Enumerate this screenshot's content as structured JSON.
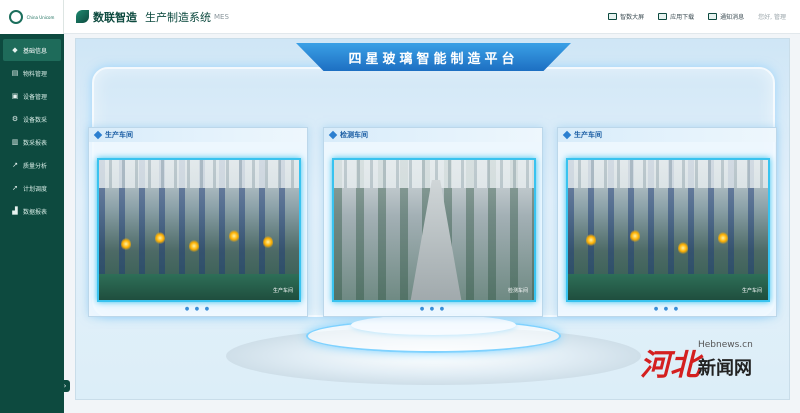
{
  "sidebar": {
    "logo_caption": "China Unicom",
    "items": [
      {
        "label": "基础信息",
        "icon": "diamond-icon",
        "active": true
      },
      {
        "label": "物料管理",
        "icon": "box-icon"
      },
      {
        "label": "设备管理",
        "icon": "monitor-icon"
      },
      {
        "label": "设备数采",
        "icon": "gear-icon"
      },
      {
        "label": "数采报表",
        "icon": "bar-chart-icon"
      },
      {
        "label": "质量分析",
        "icon": "line-chart-icon"
      },
      {
        "label": "计划调度",
        "icon": "arrow-icon"
      },
      {
        "label": "数据报表",
        "icon": "area-chart-icon"
      }
    ],
    "collapse_symbol": "›"
  },
  "header": {
    "brand": "数联智造",
    "system_title": "生产制造系统",
    "system_sub": "MES",
    "actions": [
      {
        "label": "智数大屏",
        "icon": "screen-icon"
      },
      {
        "label": "应用下载",
        "icon": "download-icon"
      },
      {
        "label": "通知消息",
        "icon": "mail-icon"
      }
    ],
    "user": "您好, 管理"
  },
  "main": {
    "banner_title": "四星玻璃智能制造平台",
    "panels": [
      {
        "title": "生产车间",
        "stamp": "生产车间"
      },
      {
        "title": "检测车间",
        "stamp": "检测车间"
      },
      {
        "title": "生产车间",
        "stamp": "生产车间"
      }
    ],
    "dots": "● ● ●"
  },
  "watermark": {
    "big": "河北",
    "site": "Hebnews.cn",
    "cn": "新闻网"
  }
}
